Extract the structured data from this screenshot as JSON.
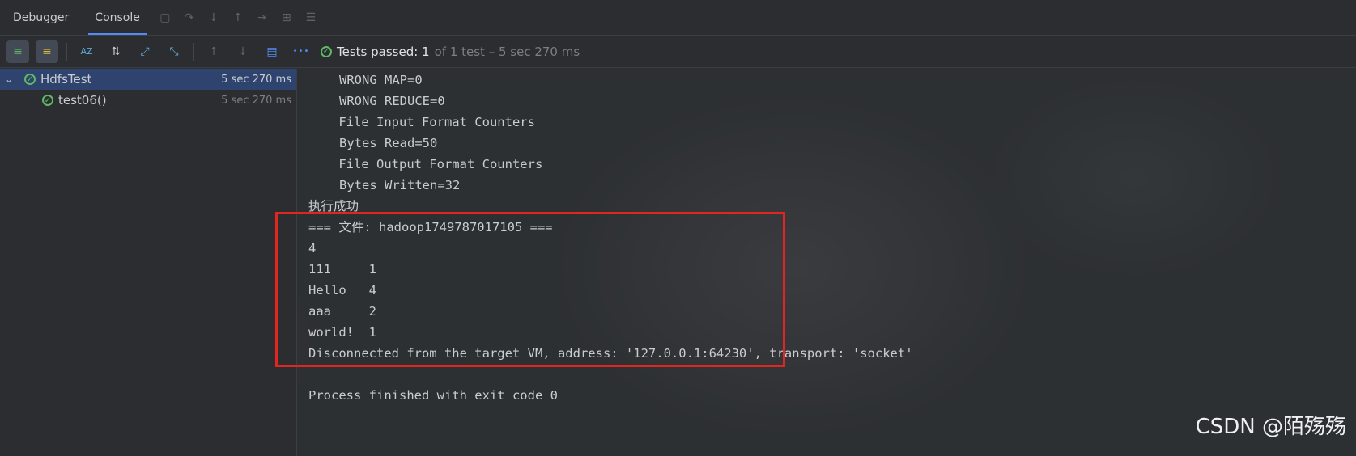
{
  "tabs": [
    {
      "label": "Debugger",
      "active": false
    },
    {
      "label": "Console",
      "active": true
    }
  ],
  "toolbar": {
    "status_label": "Tests passed: 1",
    "status_detail": "of 1 test – 5 sec 270 ms",
    "more": "•••"
  },
  "tree": [
    {
      "name": "HdfsTest",
      "duration": "5 sec 270 ms",
      "selected": true
    },
    {
      "name": "test06()",
      "duration": "5 sec 270 ms",
      "selected": false
    }
  ],
  "console": {
    "lines": [
      "\t\tWRONG_MAP=0",
      "\t\tWRONG_REDUCE=0",
      "\tFile Input Format Counters ",
      "\t\tBytes Read=50",
      "\tFile Output Format Counters ",
      "\t\tBytes Written=32",
      "执行成功",
      "=== 文件: hadoop1749787017105 ===",
      "4",
      "111\t1",
      "Hello\t4",
      "aaa\t2",
      "world!\t1",
      "Disconnected from the target VM, address: '127.0.0.1:64230', transport: 'socket'",
      "",
      "Process finished with exit code 0"
    ]
  },
  "watermark": "CSDN @陌殇殇",
  "colors": {
    "pass_green": "#5fb865",
    "highlight_red": "#e0261e",
    "accent_blue": "#548af7"
  }
}
